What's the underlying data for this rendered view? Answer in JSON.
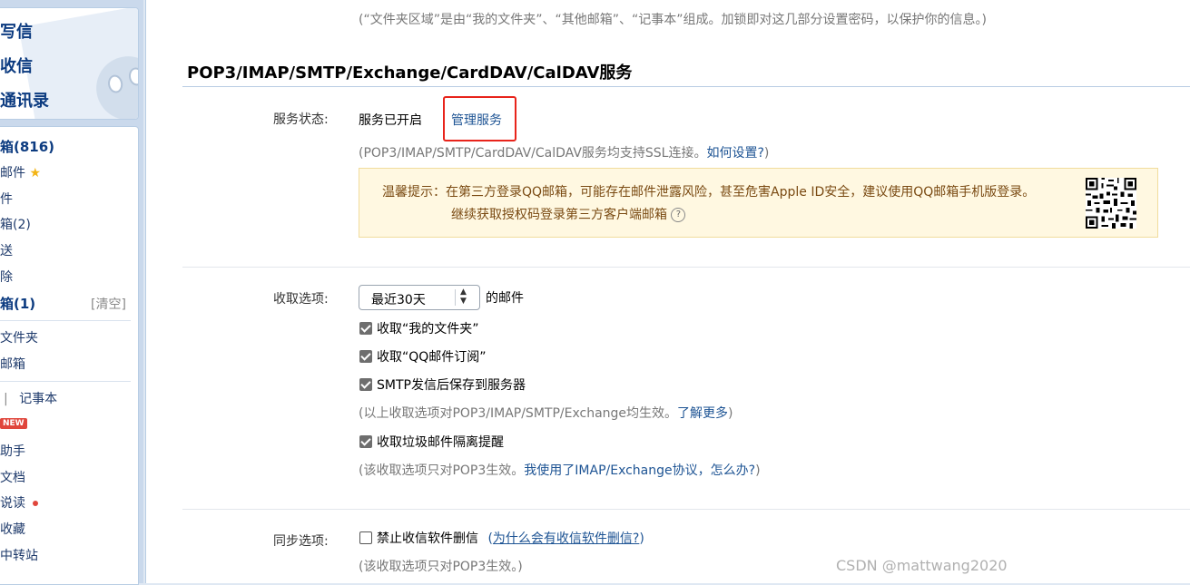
{
  "sidebar": {
    "quick": {
      "compose": "写信",
      "receive": "收信",
      "contacts": "通讯录"
    },
    "folders": {
      "inbox": "箱(816)",
      "starred": "邮件",
      "group": "件",
      "drafts": "箱(2)",
      "sent": "送",
      "deleted": "除",
      "trash": "箱(1)",
      "trash_clear": "[清空]",
      "my_folders": "文件夹",
      "other_mail": "邮箱",
      "pipe": "|",
      "notepad": "记事本",
      "new_badge": "NEW",
      "assistant": "助手",
      "docs": "文档",
      "reading": "说读",
      "favorites": "收藏",
      "transfer": "中转站"
    }
  },
  "main": {
    "top_note": "(“文件夹区域”是由“我的文件夹”、“其他邮箱”、“记事本”组成。加锁即对这几部分设置密码，以保护你的信息。)",
    "section_title": "POP3/IMAP/SMTP/Exchange/CardDAV/CalDAV服务",
    "service_status_label": "服务状态:",
    "service_status_value": "服务已开启",
    "manage_service_link": "管理服务",
    "ssl_note_prefix": "(POP3/IMAP/SMTP/CardDAV/CalDAV服务均支持SSL连接。",
    "ssl_note_link": "如何设置?",
    "ssl_note_suffix": ")",
    "tip_line1": "温馨提示：在第三方登录QQ邮箱，可能存在邮件泄露风险，甚至危害Apple ID安全，建议使用QQ邮箱手机版登录。",
    "tip_line2": "继续获取授权码登录第三方客户端邮箱",
    "tip_help": "?",
    "receive_label": "收取选项:",
    "receive_select": "最近30天",
    "receive_suffix": "的邮件",
    "opt_my_folders": "收取“我的文件夹”",
    "opt_subscriptions": "收取“QQ邮件订阅”",
    "opt_smtp_save": "SMTP发信后保存到服务器",
    "receive_note_prefix": "(以上收取选项对POP3/IMAP/SMTP/Exchange均生效。",
    "receive_note_link": "了解更多",
    "receive_note_suffix": ")",
    "opt_spam": "收取垃圾邮件隔离提醒",
    "spam_note_prefix": "(该收取选项只对POP3生效。",
    "spam_note_link": "我使用了IMAP/Exchange协议，怎么办?",
    "spam_note_suffix": ")",
    "sync_label": "同步选项:",
    "opt_no_delete": "禁止收信软件删信",
    "sync_link_open": "(",
    "sync_link": "为什么会有收信软件删信?",
    "sync_link_close": ")",
    "sync_note": "(该收取选项只对POP3生效。)"
  },
  "checkbox_states": {
    "my_folders": true,
    "subscriptions": true,
    "smtp_save": true,
    "spam": true,
    "no_delete": false
  },
  "watermark": "CSDN @mattwang2020",
  "colors": {
    "link": "#1e5494",
    "highlight_box": "#e8241b",
    "tip_bg": "#fff8e1",
    "tip_text": "#7a4a12",
    "page_bg": "#dfe8f3"
  }
}
